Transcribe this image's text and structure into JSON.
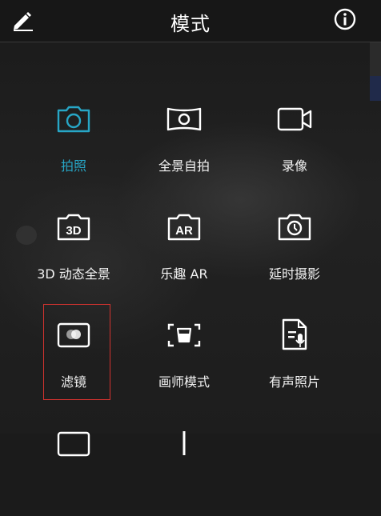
{
  "header": {
    "title": "模式"
  },
  "modes": [
    {
      "label": "拍照",
      "icon": "camera-icon",
      "active": true
    },
    {
      "label": "全景自拍",
      "icon": "panorama-selfie-icon",
      "active": false
    },
    {
      "label": "录像",
      "icon": "video-icon",
      "active": false
    },
    {
      "label": "3D 动态全景",
      "icon": "3d-panorama-icon",
      "active": false
    },
    {
      "label": "乐趣 AR",
      "icon": "ar-icon",
      "active": false
    },
    {
      "label": "延时摄影",
      "icon": "timelapse-icon",
      "active": false
    },
    {
      "label": "滤镜",
      "icon": "filter-icon",
      "active": false
    },
    {
      "label": "画师模式",
      "icon": "artist-mode-icon",
      "active": false
    },
    {
      "label": "有声照片",
      "icon": "audio-photo-icon",
      "active": false
    }
  ],
  "icon_text": {
    "three_d": "3D",
    "ar": "AR"
  },
  "colors": {
    "accent": "#27a6c6",
    "selection": "#d2332f",
    "icon": "#ffffff"
  }
}
